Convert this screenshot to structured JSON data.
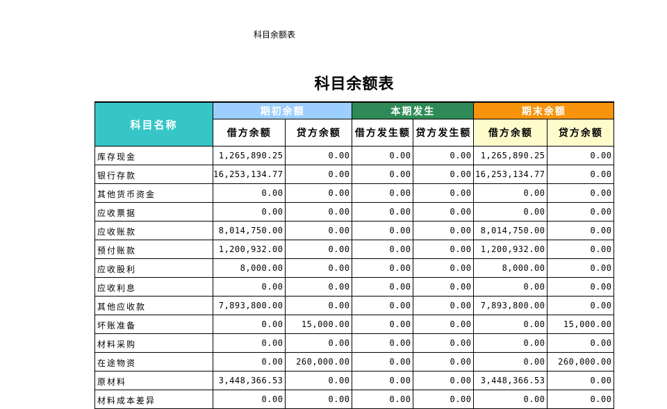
{
  "doc_label": "科目余额表",
  "title": "科目余额表",
  "header": {
    "account_name": "科目名称",
    "groups": {
      "opening": "期初余额",
      "period": "本期发生",
      "closing": "期末余额"
    },
    "subs": {
      "opening_debit": "借方余额",
      "opening_credit": "贷方余额",
      "period_debit": "借方发生额",
      "period_credit": "贷方发生额",
      "closing_debit": "借方余额",
      "closing_credit": "贷方余额"
    }
  },
  "colors": {
    "account_header": "#36c6c8",
    "opening_header": "#9ccfff",
    "period_header": "#2e8b57",
    "closing_header": "#f7930c",
    "closing_sub_bg": "#fffccc"
  },
  "rows": [
    [
      "库存现金",
      "1,265,890.25",
      "0.00",
      "0.00",
      "0.00",
      "1,265,890.25",
      "0.00"
    ],
    [
      "银行存款",
      "16,253,134.77",
      "0.00",
      "0.00",
      "0.00",
      "16,253,134.77",
      "0.00"
    ],
    [
      "其他货币资金",
      "0.00",
      "0.00",
      "0.00",
      "0.00",
      "0.00",
      "0.00"
    ],
    [
      "应收票据",
      "0.00",
      "0.00",
      "0.00",
      "0.00",
      "0.00",
      "0.00"
    ],
    [
      "应收账款",
      "8,014,750.00",
      "0.00",
      "0.00",
      "0.00",
      "8,014,750.00",
      "0.00"
    ],
    [
      "预付账款",
      "1,200,932.00",
      "0.00",
      "0.00",
      "0.00",
      "1,200,932.00",
      "0.00"
    ],
    [
      "应收股利",
      "8,000.00",
      "0.00",
      "0.00",
      "0.00",
      "8,000.00",
      "0.00"
    ],
    [
      "应收利息",
      "0.00",
      "0.00",
      "0.00",
      "0.00",
      "0.00",
      "0.00"
    ],
    [
      "其他应收款",
      "7,893,800.00",
      "0.00",
      "0.00",
      "0.00",
      "7,893,800.00",
      "0.00"
    ],
    [
      "坏账准备",
      "0.00",
      "15,000.00",
      "0.00",
      "0.00",
      "0.00",
      "15,000.00"
    ],
    [
      "材料采购",
      "0.00",
      "0.00",
      "0.00",
      "0.00",
      "0.00",
      "0.00"
    ],
    [
      "在途物资",
      "0.00",
      "260,000.00",
      "0.00",
      "0.00",
      "0.00",
      "260,000.00"
    ],
    [
      "原材料",
      "3,448,366.53",
      "0.00",
      "0.00",
      "0.00",
      "3,448,366.53",
      "0.00"
    ],
    [
      "材料成本差异",
      "0.00",
      "0.00",
      "0.00",
      "0.00",
      "0.00",
      "0.00"
    ]
  ]
}
